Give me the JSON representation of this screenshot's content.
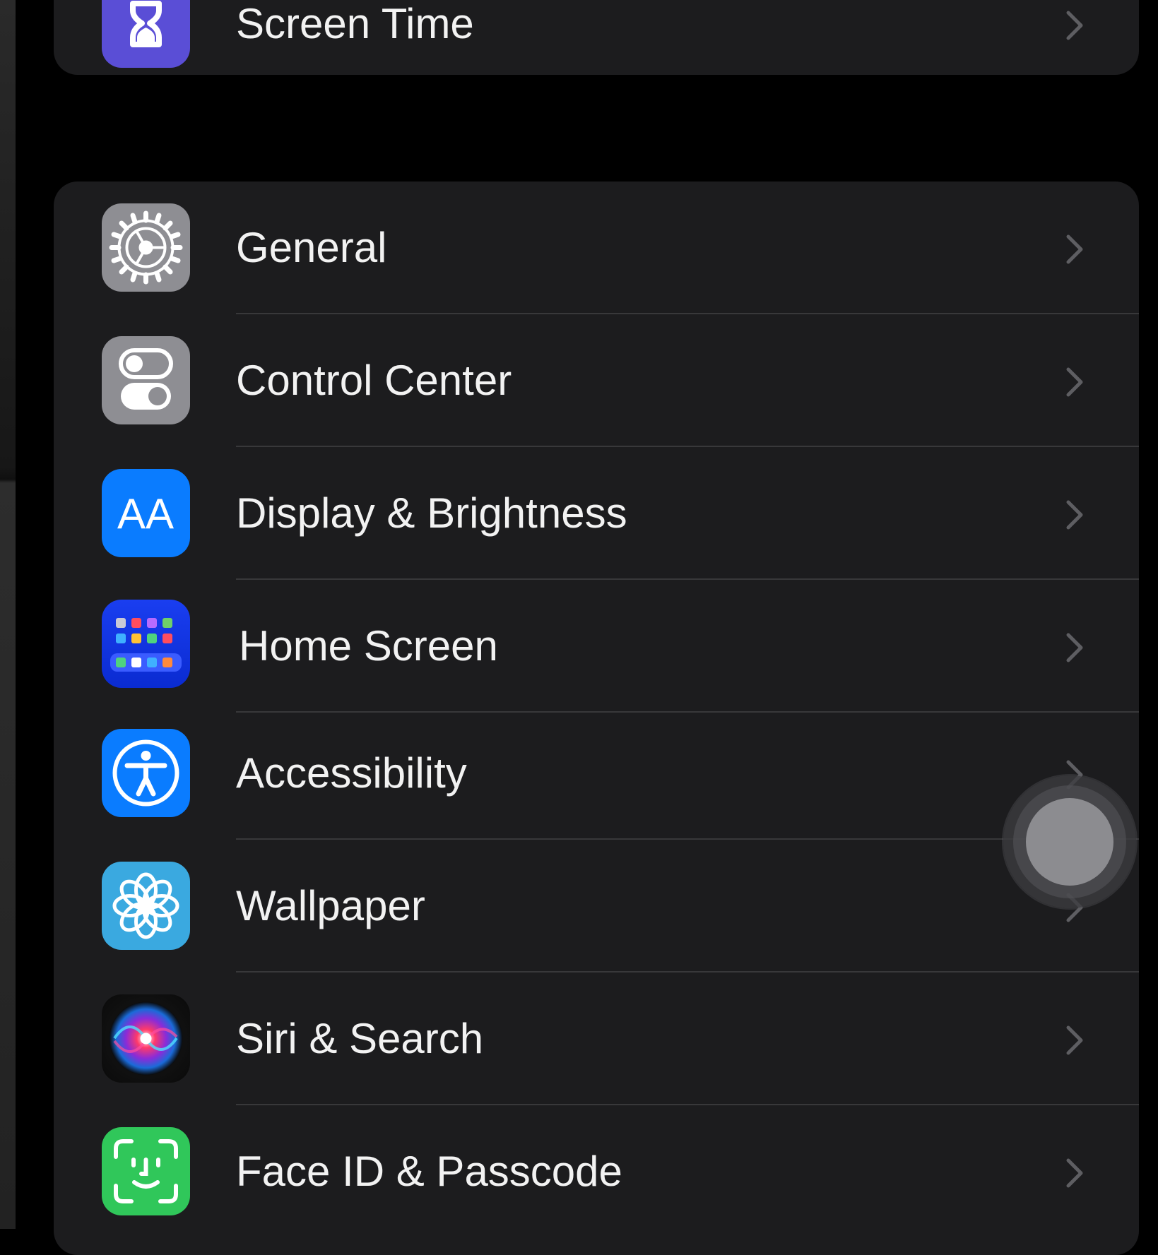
{
  "colors": {
    "background": "#000000",
    "group_background": "#1c1c1e",
    "separator": "#38383a",
    "chevron": "#5e5e62",
    "label": "#f2f2f2"
  },
  "top_group": {
    "screen_time": {
      "label": "Screen Time",
      "icon": "hourglass-icon",
      "icon_color": "#5a4ed6"
    }
  },
  "main_group": {
    "items": [
      {
        "label": "General",
        "icon": "gear-icon",
        "icon_color": "#8e8e93"
      },
      {
        "label": "Control Center",
        "icon": "toggles-icon",
        "icon_color": "#8e8e93"
      },
      {
        "label": "Display & Brightness",
        "icon": "text-size-icon",
        "icon_color": "#0a7cff"
      },
      {
        "label": "Home Screen",
        "icon": "app-grid-icon",
        "icon_color": "#1a3ef0"
      },
      {
        "label": "Accessibility",
        "icon": "accessibility-icon",
        "icon_color": "#0a7cff"
      },
      {
        "label": "Wallpaper",
        "icon": "flower-icon",
        "icon_color": "#3aa9e0"
      },
      {
        "label": "Siri & Search",
        "icon": "siri-icon",
        "icon_color": "#0a0a0a"
      },
      {
        "label": "Face ID & Passcode",
        "icon": "face-id-icon",
        "icon_color": "#30c75a"
      }
    ]
  },
  "assistive_touch": {
    "icon": "assistive-touch-icon"
  },
  "display_icon_text": "AA"
}
